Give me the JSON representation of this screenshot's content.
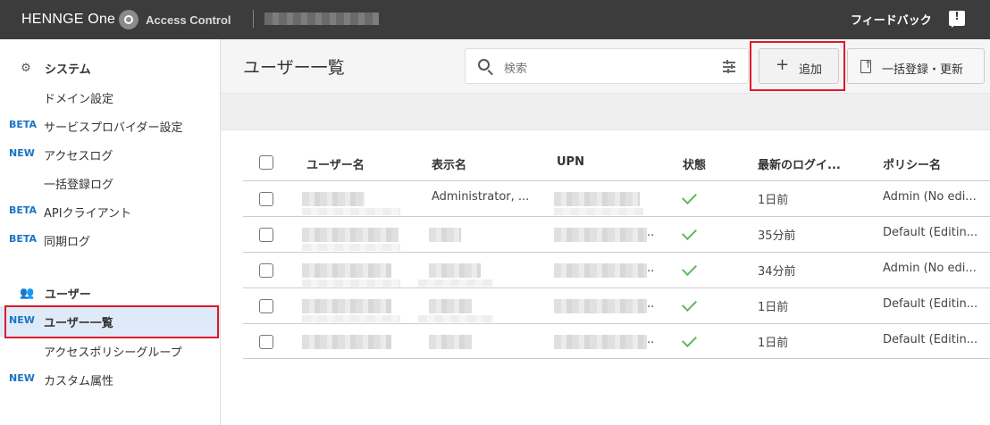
{
  "header": {
    "logo_text": "HENNGE One",
    "product": "Access Control",
    "feedback": "フィードバック"
  },
  "sidebar": {
    "system_title": "システム",
    "user_title": "ユーザー",
    "items": [
      {
        "badge": "",
        "label": "ドメイン設定"
      },
      {
        "badge": "BETA",
        "label": "サービスプロバイダー設定"
      },
      {
        "badge": "NEW",
        "label": "アクセスログ"
      },
      {
        "badge": "",
        "label": "一括登録ログ"
      },
      {
        "badge": "BETA",
        "label": "APIクライアント"
      },
      {
        "badge": "BETA",
        "label": "同期ログ"
      },
      {
        "badge": "NEW",
        "label": "ユーザー一覧"
      },
      {
        "badge": "",
        "label": "アクセスポリシーグループ"
      },
      {
        "badge": "NEW",
        "label": "カスタム属性"
      }
    ]
  },
  "main": {
    "title": "ユーザー一覧",
    "search_placeholder": "検索",
    "add_label": "追加",
    "bulk_label": "一括登録・更新"
  },
  "table": {
    "headers": [
      "ユーザー名",
      "表示名",
      "UPN",
      "状態",
      "最新のログイ...",
      "ポリシー名"
    ],
    "rows": [
      {
        "display_name": "Administrator, ...",
        "upn_suffix": "",
        "last_login": "1日前",
        "policy": "Admin (No edi..."
      },
      {
        "display_name": "",
        "upn_suffix": "..",
        "last_login": "35分前",
        "policy": "Default (Editin..."
      },
      {
        "display_name": "",
        "upn_suffix": "..",
        "last_login": "34分前",
        "policy": "Admin (No edi..."
      },
      {
        "display_name": "",
        "upn_suffix": "..",
        "last_login": "1日前",
        "policy": "Default (Editin..."
      },
      {
        "display_name": "",
        "upn_suffix": "..",
        "last_login": "1日前",
        "policy": "Default (Editin..."
      }
    ]
  }
}
